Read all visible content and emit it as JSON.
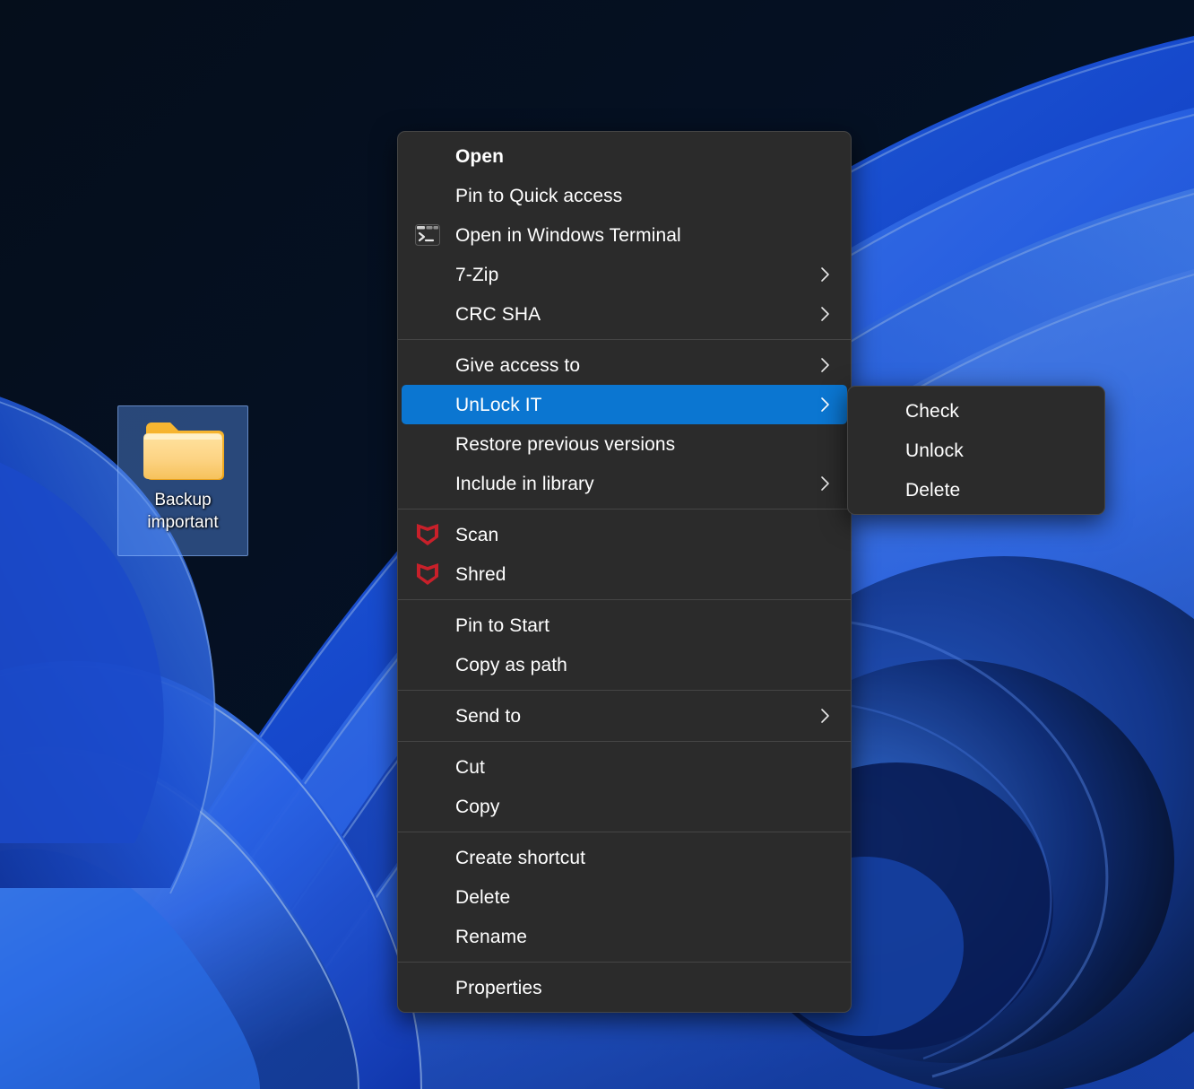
{
  "desktop": {
    "icon": {
      "name": "folder-icon",
      "label": "Backup\nimportant",
      "label_line1": "Backup",
      "label_line2": "important",
      "selected": true
    },
    "wallpaper_colors": {
      "deep_navy": "#050d1e",
      "mid_blue": "#1a4fd6",
      "bright_blue": "#2f7bff",
      "light_blue": "#6ba6ff",
      "highlight": "#9ec8ff"
    }
  },
  "context_menu": {
    "accent": "#0b76d1",
    "background": "#2b2b2b",
    "border": "#454545",
    "text": "#ffffff",
    "groups": [
      {
        "items": [
          {
            "label": "Open",
            "bold": true,
            "icon": null,
            "submenu": false
          },
          {
            "label": "Pin to Quick access",
            "bold": false,
            "icon": null,
            "submenu": false
          },
          {
            "label": "Open in Windows Terminal",
            "bold": false,
            "icon": "terminal-icon",
            "submenu": false
          },
          {
            "label": "7-Zip",
            "bold": false,
            "icon": null,
            "submenu": true
          },
          {
            "label": "CRC SHA",
            "bold": false,
            "icon": null,
            "submenu": true
          }
        ]
      },
      {
        "items": [
          {
            "label": "Give access to",
            "bold": false,
            "icon": null,
            "submenu": true
          },
          {
            "label": "UnLock IT",
            "bold": false,
            "icon": null,
            "submenu": true,
            "selected": true
          },
          {
            "label": "Restore previous versions",
            "bold": false,
            "icon": null,
            "submenu": false
          },
          {
            "label": "Include in library",
            "bold": false,
            "icon": null,
            "submenu": true
          }
        ]
      },
      {
        "items": [
          {
            "label": "Scan",
            "bold": false,
            "icon": "mcafee-shield-icon",
            "submenu": false
          },
          {
            "label": "Shred",
            "bold": false,
            "icon": "mcafee-shield-icon",
            "submenu": false
          }
        ]
      },
      {
        "items": [
          {
            "label": "Pin to Start",
            "bold": false,
            "icon": null,
            "submenu": false
          },
          {
            "label": "Copy as path",
            "bold": false,
            "icon": null,
            "submenu": false
          }
        ]
      },
      {
        "items": [
          {
            "label": "Send to",
            "bold": false,
            "icon": null,
            "submenu": true
          }
        ]
      },
      {
        "items": [
          {
            "label": "Cut",
            "bold": false,
            "icon": null,
            "submenu": false
          },
          {
            "label": "Copy",
            "bold": false,
            "icon": null,
            "submenu": false
          }
        ]
      },
      {
        "items": [
          {
            "label": "Create shortcut",
            "bold": false,
            "icon": null,
            "submenu": false
          },
          {
            "label": "Delete",
            "bold": false,
            "icon": null,
            "submenu": false
          },
          {
            "label": "Rename",
            "bold": false,
            "icon": null,
            "submenu": false
          }
        ]
      },
      {
        "items": [
          {
            "label": "Properties",
            "bold": false,
            "icon": null,
            "submenu": false
          }
        ]
      }
    ]
  },
  "submenu": {
    "parent": "UnLock IT",
    "items": [
      {
        "label": "Check"
      },
      {
        "label": "Unlock"
      },
      {
        "label": "Delete"
      }
    ]
  }
}
